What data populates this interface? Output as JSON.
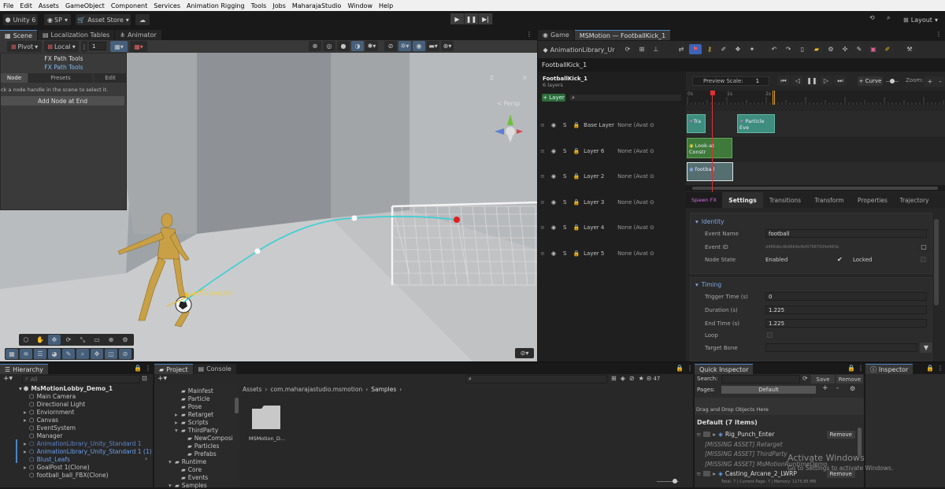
{
  "menu": [
    "File",
    "Edit",
    "Assets",
    "GameObject",
    "Component",
    "Services",
    "Animation Rigging",
    "Tools",
    "Jobs",
    "MaharajaStudio",
    "Window",
    "Help"
  ],
  "toolbar": {
    "unity_label": "Unity 6",
    "account_label": "SP",
    "asset_store_label": "Asset Store",
    "layout_label": "Layout"
  },
  "scene_tabs": [
    "Scene",
    "Localization Tables",
    "Animator"
  ],
  "scene_toolbar": {
    "pivot_label": "Pivot",
    "local_label": "Local",
    "snap_value": "1"
  },
  "fx_panel": {
    "title": "FX Path Tools",
    "subtitle": "FX Path Tools",
    "tabs": [
      "Node",
      "Presets",
      "Edit"
    ],
    "hint": "ck a node handle in the scene to select it.",
    "add_node_label": "Add Node at End"
  },
  "viewport": {
    "persp_label": "< Persp",
    "axis_z": "Z",
    "axis_x": "X",
    "node_label": "0.70s (t=0.57)"
  },
  "right_tabs": [
    "Game",
    "MSMotion — FootballKick_1"
  ],
  "motion": {
    "library_dropdown": "AnimationLibrary_Ur",
    "clip_name": "FootballKick_1",
    "clip_title": "FootballKick_1",
    "layer_count": "6 layers",
    "add_layer_label": "+ Layer",
    "preview_scale_label": "Preview Scale:",
    "preview_scale_value": "1",
    "curve_label": "+ Curve",
    "zoom_label": "Zoom:",
    "ruler": [
      "0s",
      "1s",
      "2s"
    ],
    "layers": [
      {
        "name": "Base Layer",
        "avatar": "None (Avat"
      },
      {
        "name": "Layer 6",
        "avatar": "None (Avat"
      },
      {
        "name": "Layer 2",
        "avatar": "None (Avat"
      },
      {
        "name": "Layer 3",
        "avatar": "None (Avat"
      },
      {
        "name": "Layer 4",
        "avatar": "None (Avat"
      },
      {
        "name": "Layer 5",
        "avatar": "None (Avat"
      }
    ],
    "solo_label": "S",
    "clips": [
      "Tra",
      "Particle Eve",
      "Look-at Constr",
      "football"
    ],
    "detail_tabs": [
      "Spawn FX",
      "Settings",
      "Transitions",
      "Transform",
      "Properties",
      "Trajectory"
    ],
    "identity": {
      "header": "Identity",
      "event_name_label": "Event Name",
      "event_name": "football",
      "event_id_label": "Event ID",
      "event_id": "d468dbc4b9664e4bf07687934d483e",
      "node_state_label": "Node State",
      "enabled_label": "Enabled",
      "locked_label": "Locked"
    },
    "timing": {
      "header": "Timing",
      "trigger_label": "Trigger Time (s)",
      "trigger": "0",
      "duration_label": "Duration (s)",
      "duration": "1.225",
      "end_label": "End Time (s)",
      "end": "1.225",
      "loop_label": "Loop",
      "bone_label": "Target Bone"
    }
  },
  "hierarchy": {
    "tab": "Hierarchy",
    "search": "All",
    "root": "MsMotionLobby_Demo_1",
    "items": [
      {
        "name": "Main Camera",
        "indent": 1,
        "color": "#c4c4c4",
        "arrow": ""
      },
      {
        "name": "Directional Light",
        "indent": 1,
        "color": "#c4c4c4",
        "arrow": ""
      },
      {
        "name": "Enviornment",
        "indent": 1,
        "color": "#c4c4c4",
        "arrow": "▸"
      },
      {
        "name": "Canvas",
        "indent": 1,
        "color": "#c4c4c4",
        "arrow": "▸"
      },
      {
        "name": "EventSystem",
        "indent": 1,
        "color": "#c4c4c4",
        "arrow": ""
      },
      {
        "name": "Manager",
        "indent": 1,
        "color": "#c4c4c4",
        "arrow": ""
      },
      {
        "name": "AnimationLibrary_Unity_Standard 1",
        "indent": 1,
        "color": "#5c86c7",
        "arrow": "▸"
      },
      {
        "name": "AnimationLibrary_Unity_Standard 1 (1)",
        "indent": 1,
        "color": "#6aa1ee",
        "arrow": "▸"
      },
      {
        "name": "Blust_Leafs",
        "indent": 1,
        "color": "#6aa1ee",
        "arrow": ""
      },
      {
        "name": "GoalPost 1(Clone)",
        "indent": 1,
        "color": "#c4c4c4",
        "arrow": "▸"
      },
      {
        "name": "football_ball_FBX(Clone)",
        "indent": 1,
        "color": "#c4c4c4",
        "arrow": ""
      }
    ]
  },
  "project": {
    "tabs": [
      "Project",
      "Console"
    ],
    "count": "47",
    "breadcrumb": [
      "Assets",
      "com.maharajastudio.msmotion",
      "Samples"
    ],
    "tree": [
      {
        "name": "Mainfest",
        "indent": 3,
        "arrow": ""
      },
      {
        "name": "Particle",
        "indent": 3,
        "arrow": ""
      },
      {
        "name": "Pose",
        "indent": 3,
        "arrow": ""
      },
      {
        "name": "Retarget",
        "indent": 3,
        "arrow": "▸"
      },
      {
        "name": "Scripts",
        "indent": 3,
        "arrow": "▸"
      },
      {
        "name": "ThirdParty",
        "indent": 3,
        "arrow": "▾"
      },
      {
        "name": "NewComposi",
        "indent": 4,
        "arrow": ""
      },
      {
        "name": "Particles",
        "indent": 4,
        "arrow": ""
      },
      {
        "name": "Prefabs",
        "indent": 4,
        "arrow": ""
      },
      {
        "name": "Runtime",
        "indent": 2,
        "arrow": "▾"
      },
      {
        "name": "Core",
        "indent": 3,
        "arrow": ""
      },
      {
        "name": "Events",
        "indent": 3,
        "arrow": ""
      },
      {
        "name": "Samples",
        "indent": 2,
        "arrow": "▾"
      }
    ],
    "folder_label": "MSMotion_D..."
  },
  "quick": {
    "tab": "Quick Inspector",
    "search_label": "Search:",
    "save_label": "Save",
    "remove_label": "Remove",
    "pages_label": "Pages:",
    "page_value": "Default",
    "drop_hint": "Drag and Drop Objects Here",
    "group": "Default (7 items)",
    "items": [
      {
        "name": "Rig_Punch_Enter",
        "missing": false,
        "btn": "Remove"
      },
      {
        "name": "[MISSING ASSET] Retarget",
        "missing": true,
        "btn": ""
      },
      {
        "name": "[MISSING ASSET] ThirdParty",
        "missing": true,
        "btn": ""
      },
      {
        "name": "[MISSING ASSET] MsMotionRuntimeDemo",
        "missing": true,
        "btn": ""
      },
      {
        "name": "Casting_Arcane_2_LWRP",
        "missing": false,
        "btn": "Remove"
      }
    ],
    "status": "Total: 7 | Current Page: 7 | Memory: 1175.85 MB"
  },
  "inspector": {
    "tab": "Inspector"
  },
  "watermark": {
    "title": "Activate Windows",
    "subtitle": "Go to Settings to activate Windows."
  },
  "colors": {
    "accent": "#4a86c7",
    "clip_teal": "#3e8d7e",
    "clip_green": "#3e7a3a",
    "playhead": "#e03131",
    "trajectory": "#35d0d6"
  }
}
